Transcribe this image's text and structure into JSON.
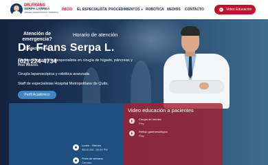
{
  "logo": {
    "line1": "DR.FRANS",
    "line2": "SERPA LARREA",
    "line3": "CIRUGÍA LAPAROSCÓPICA Y ROBÓTICA"
  },
  "nav": {
    "items": [
      {
        "label": "INICIO",
        "active": true
      },
      {
        "label": "EL ESPECIALISTA",
        "active": false
      },
      {
        "label": "PROCEDIMIENTOS",
        "active": false,
        "has_dropdown": true
      },
      {
        "label": "ROBÓTICA",
        "active": false
      },
      {
        "label": "MEDIOS",
        "active": false
      },
      {
        "label": "CONTACTO",
        "active": false
      }
    ],
    "cta_label": "Video Educación",
    "cta_icon": "play-icon"
  },
  "hero": {
    "title": "Dr. Frans Serpa L.",
    "description": "Cirujano Digestivo, subespecialista en cirugía de hígado, páncreas y vías biliares.",
    "line2": "Cirugía laparoscópica y robótica avanzada",
    "line3": "Staff de especialistas Hospital Metropolitano de Quito.",
    "button_label": "Perfil Académico"
  },
  "emergency": {
    "title": "Atención de emergencia?",
    "contact_label": "Contáctenos al:",
    "phone": "(02) 224-4734"
  },
  "schedule": {
    "title": "Horario de atención",
    "items": [
      {
        "icon": "clock-icon",
        "line1": "Lunes - Viernes",
        "line2": "08:00 AM - 05:30 PM"
      },
      {
        "icon": "clock-icon",
        "line1": "Fines de semana",
        "line2": "Cerrado"
      }
    ]
  },
  "videos": {
    "title": "Video educación a pacientes",
    "items": [
      {
        "icon": "play-icon",
        "line1": "Cirugía de hernias",
        "line2": "Play"
      },
      {
        "icon": "play-icon",
        "line1": "Reflujo gastroesofágico",
        "line2": "Play"
      }
    ]
  },
  "colors": {
    "accent": "#c8102e",
    "navy": "#1b3a63",
    "emergency_bg": "#1f4d7d",
    "videos_bg": "#a02232",
    "profile_button": "#3f86c5"
  }
}
